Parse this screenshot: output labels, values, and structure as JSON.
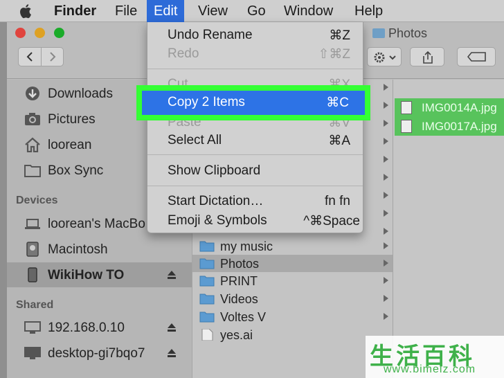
{
  "menubar": {
    "app_name": "Finder",
    "items": [
      "File",
      "Edit",
      "View",
      "Go",
      "Window",
      "Help"
    ]
  },
  "window": {
    "title": "Photos"
  },
  "edit_menu": {
    "items": [
      {
        "label": "Undo Rename",
        "shortcut": "⌘Z",
        "enabled": true
      },
      {
        "label": "Redo",
        "shortcut": "⇧⌘Z",
        "enabled": false
      },
      {
        "label": "Cut",
        "shortcut": "⌘X",
        "enabled": false
      },
      {
        "label": "Copy 2 Items",
        "shortcut": "⌘C",
        "enabled": true,
        "highlighted": true
      },
      {
        "label": "Paste",
        "shortcut": "⌘V",
        "enabled": false
      },
      {
        "label": "Select All",
        "shortcut": "⌘A",
        "enabled": true
      },
      {
        "label": "Show Clipboard",
        "shortcut": "",
        "enabled": true
      },
      {
        "label": "Start Dictation…",
        "shortcut": "fn fn",
        "enabled": true
      },
      {
        "label": "Emoji & Symbols",
        "shortcut": "^⌘Space",
        "enabled": true
      }
    ]
  },
  "sidebar": {
    "favorites": [
      {
        "label": "Downloads",
        "icon": "download-icon"
      },
      {
        "label": "Pictures",
        "icon": "camera-icon"
      },
      {
        "label": "loorean",
        "icon": "home-icon"
      },
      {
        "label": "Box Sync",
        "icon": "folder-icon"
      }
    ],
    "devices_header": "Devices",
    "devices": [
      {
        "label": "loorean's MacBo",
        "icon": "laptop-icon"
      },
      {
        "label": "Macintosh",
        "icon": "hard-drive-icon"
      },
      {
        "label": "WikiHow TO",
        "icon": "external-drive-icon",
        "selected": true
      }
    ],
    "shared_header": "Shared",
    "shared": [
      {
        "label": "192.168.0.10",
        "icon": "monitor-icon"
      },
      {
        "label": "desktop-gi7bqo7",
        "icon": "monitor-icon"
      }
    ]
  },
  "column1": {
    "items": [
      {
        "label": "my music",
        "type": "folder"
      },
      {
        "label": "Photos",
        "type": "folder",
        "selected": true
      },
      {
        "label": "PRINT",
        "type": "folder"
      },
      {
        "label": "Videos",
        "type": "folder"
      },
      {
        "label": "Voltes V",
        "type": "folder"
      },
      {
        "label": "yes.ai",
        "type": "file"
      }
    ]
  },
  "column2": {
    "files": [
      "IMG0014A.jpg",
      "IMG0017A.jpg"
    ]
  },
  "watermark": {
    "chars": "生活百科",
    "url": "www.bimeiz.com"
  },
  "colors": {
    "menu_highlight": "#2d73e6",
    "callout_frame": "#34ff34",
    "file_selection": "#58c35c"
  }
}
